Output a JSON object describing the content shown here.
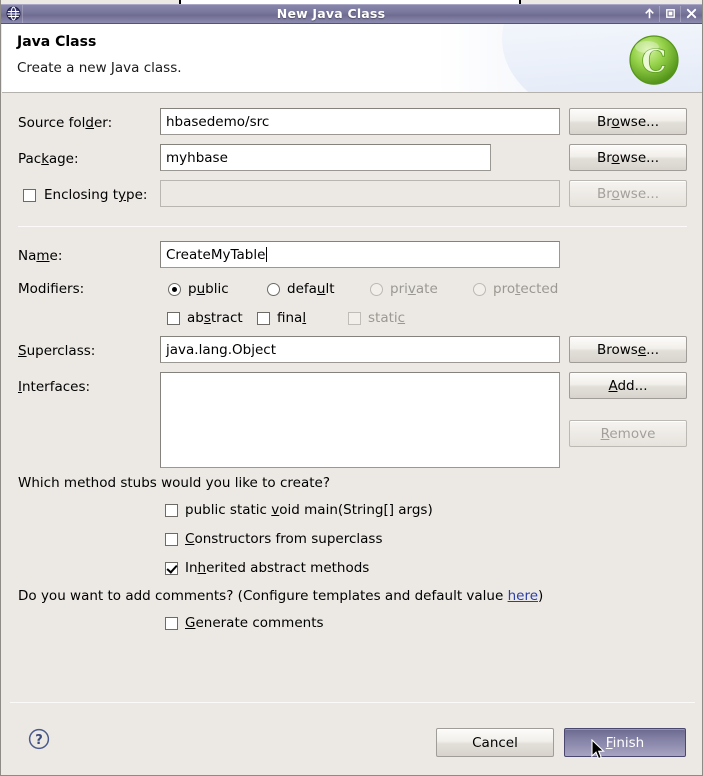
{
  "window": {
    "title": "New Java Class",
    "app_icon": "eclipse-icon",
    "buttons": {
      "minimize": "minimize-icon",
      "maximize": "maximize-icon",
      "close": "close-icon"
    }
  },
  "header": {
    "title": "Java Class",
    "subtitle": "Create a new Java class.",
    "logo": "java-class-c-logo"
  },
  "form": {
    "source_folder": {
      "label": "Source folder:",
      "label_pre": "Source fol",
      "label_mnemonic": "d",
      "label_post": "er:",
      "value": "hbasedemo/src",
      "browse_label": "Browse...",
      "browse_pre": "Br",
      "browse_mnemonic": "o",
      "browse_post": "wse..."
    },
    "package": {
      "label": "Package:",
      "label_pre": "Pac",
      "label_mnemonic": "k",
      "label_post": "age:",
      "value": "myhbase",
      "browse_label": "Browse...",
      "browse_pre": "Br",
      "browse_mnemonic": "o",
      "browse_post": "wse..."
    },
    "enclosing_type": {
      "label": "Enclosing type:",
      "label_pre": "Enclosing t",
      "label_mnemonic": "y",
      "label_post": "pe:",
      "checked": false,
      "enabled": false,
      "value": "",
      "browse_label": "Browse...",
      "browse_pre": "Br",
      "browse_mnemonic": "o",
      "browse_post": "wse..."
    },
    "name": {
      "label": "Name:",
      "label_pre": "Na",
      "label_mnemonic": "m",
      "label_post": "e:",
      "value": "CreateMyTable"
    },
    "modifiers": {
      "label": "Modifiers:",
      "radios": [
        {
          "label": "public",
          "pre": "p",
          "mnemonic": "u",
          "post": "blic",
          "checked": true,
          "enabled": true
        },
        {
          "label": "default",
          "pre": "defa",
          "mnemonic": "u",
          "post": "lt",
          "checked": false,
          "enabled": true
        },
        {
          "label": "private",
          "pre": "pri",
          "mnemonic": "v",
          "post": "ate",
          "checked": false,
          "enabled": false
        },
        {
          "label": "protected",
          "pre": "pro",
          "mnemonic": "t",
          "post": "ected",
          "checked": false,
          "enabled": false
        }
      ],
      "checkboxes": [
        {
          "label": "abstract",
          "pre": "ab",
          "mnemonic": "s",
          "post": "tract",
          "checked": false,
          "enabled": true
        },
        {
          "label": "final",
          "pre": "fina",
          "mnemonic": "l",
          "post": "",
          "checked": false,
          "enabled": true
        },
        {
          "label": "static",
          "pre": "stati",
          "mnemonic": "c",
          "post": "",
          "checked": false,
          "enabled": false
        }
      ]
    },
    "superclass": {
      "label": "Superclass:",
      "label_pre": "",
      "label_mnemonic": "S",
      "label_post": "uperclass:",
      "value": "java.lang.Object",
      "browse_label": "Browse...",
      "browse_pre": "Brows",
      "browse_mnemonic": "e",
      "browse_post": "..."
    },
    "interfaces": {
      "label": "Interfaces:",
      "label_pre": "",
      "label_mnemonic": "I",
      "label_post": "nterfaces:",
      "items": [],
      "add_label": "Add...",
      "add_pre": "",
      "add_mnemonic": "A",
      "add_post": "dd...",
      "remove_label": "Remove",
      "remove_pre": "",
      "remove_mnemonic": "R",
      "remove_post": "emove",
      "remove_enabled": false
    },
    "method_stubs": {
      "question": "Which method stubs would you like to create?",
      "options": [
        {
          "label": "public static void main(String[] args)",
          "pre": "public static ",
          "mnemonic": "v",
          "post": "oid main(String[] args)",
          "checked": false
        },
        {
          "label": "Constructors from superclass",
          "pre": "",
          "mnemonic": "C",
          "post": "onstructors from superclass",
          "checked": false
        },
        {
          "label": "Inherited abstract methods",
          "pre": "In",
          "mnemonic": "h",
          "post": "erited abstract methods",
          "checked": true
        }
      ]
    },
    "comments": {
      "question_pre": "Do you want to add comments? (Configure templates and default value ",
      "link": "here",
      "question_post": ")",
      "option": {
        "label": "Generate comments",
        "pre": "",
        "mnemonic": "G",
        "post": "enerate comments",
        "checked": false
      }
    }
  },
  "footer": {
    "help_icon": "help-question-icon",
    "cancel_label": "Cancel",
    "finish_label": "Finish",
    "finish_pre": "",
    "finish_mnemonic": "F",
    "finish_post": "inish"
  },
  "colors": {
    "dialog_bg": "#ece9e4",
    "titlebar": "#7c799f",
    "finish_button": "#8d8aad",
    "link": "#2b3ea8",
    "logo_green": "#7ac943"
  }
}
